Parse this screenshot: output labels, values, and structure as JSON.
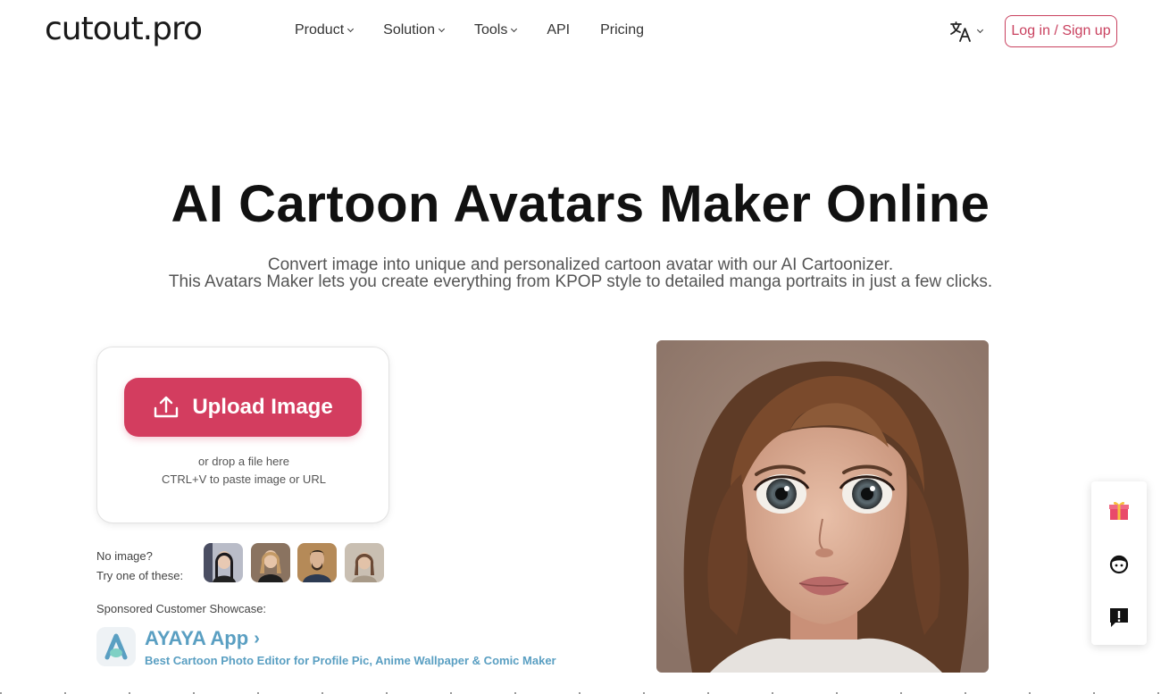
{
  "header": {
    "logo": "cutout.pro",
    "nav": [
      {
        "label": "Product",
        "dropdown": true
      },
      {
        "label": "Solution",
        "dropdown": true
      },
      {
        "label": "Tools",
        "dropdown": true
      },
      {
        "label": "API",
        "dropdown": false
      },
      {
        "label": "Pricing",
        "dropdown": false
      }
    ],
    "language_icon": "translate-icon",
    "login_label": "Log in / Sign up"
  },
  "hero": {
    "title": "AI Cartoon Avatars Maker Online",
    "subtitle_line1": "Convert image into unique and personalized cartoon avatar with our AI Cartoonizer.",
    "subtitle_line2": "This Avatars Maker lets you create everything from KPOP style to detailed manga portraits in just a few clicks."
  },
  "upload": {
    "button_label": "Upload Image",
    "hint_drop": "or drop a file here",
    "hint_paste": "CTRL+V to paste image or URL"
  },
  "samples": {
    "label_line1": "No image?",
    "label_line2": "Try one of these:",
    "count": 4
  },
  "sponsored": {
    "label": "Sponsored Customer Showcase:",
    "app_name": "AYAYA App",
    "arrow": "›",
    "app_desc": "Best Cartoon Photo Editor for Profile Pic, Anime Wallpaper & Comic Maker"
  },
  "side_panel": {
    "items": [
      "gift-icon",
      "support-face-icon",
      "feedback-icon"
    ]
  },
  "colors": {
    "brand": "#d33d5f",
    "link": "#5a9fc2"
  }
}
